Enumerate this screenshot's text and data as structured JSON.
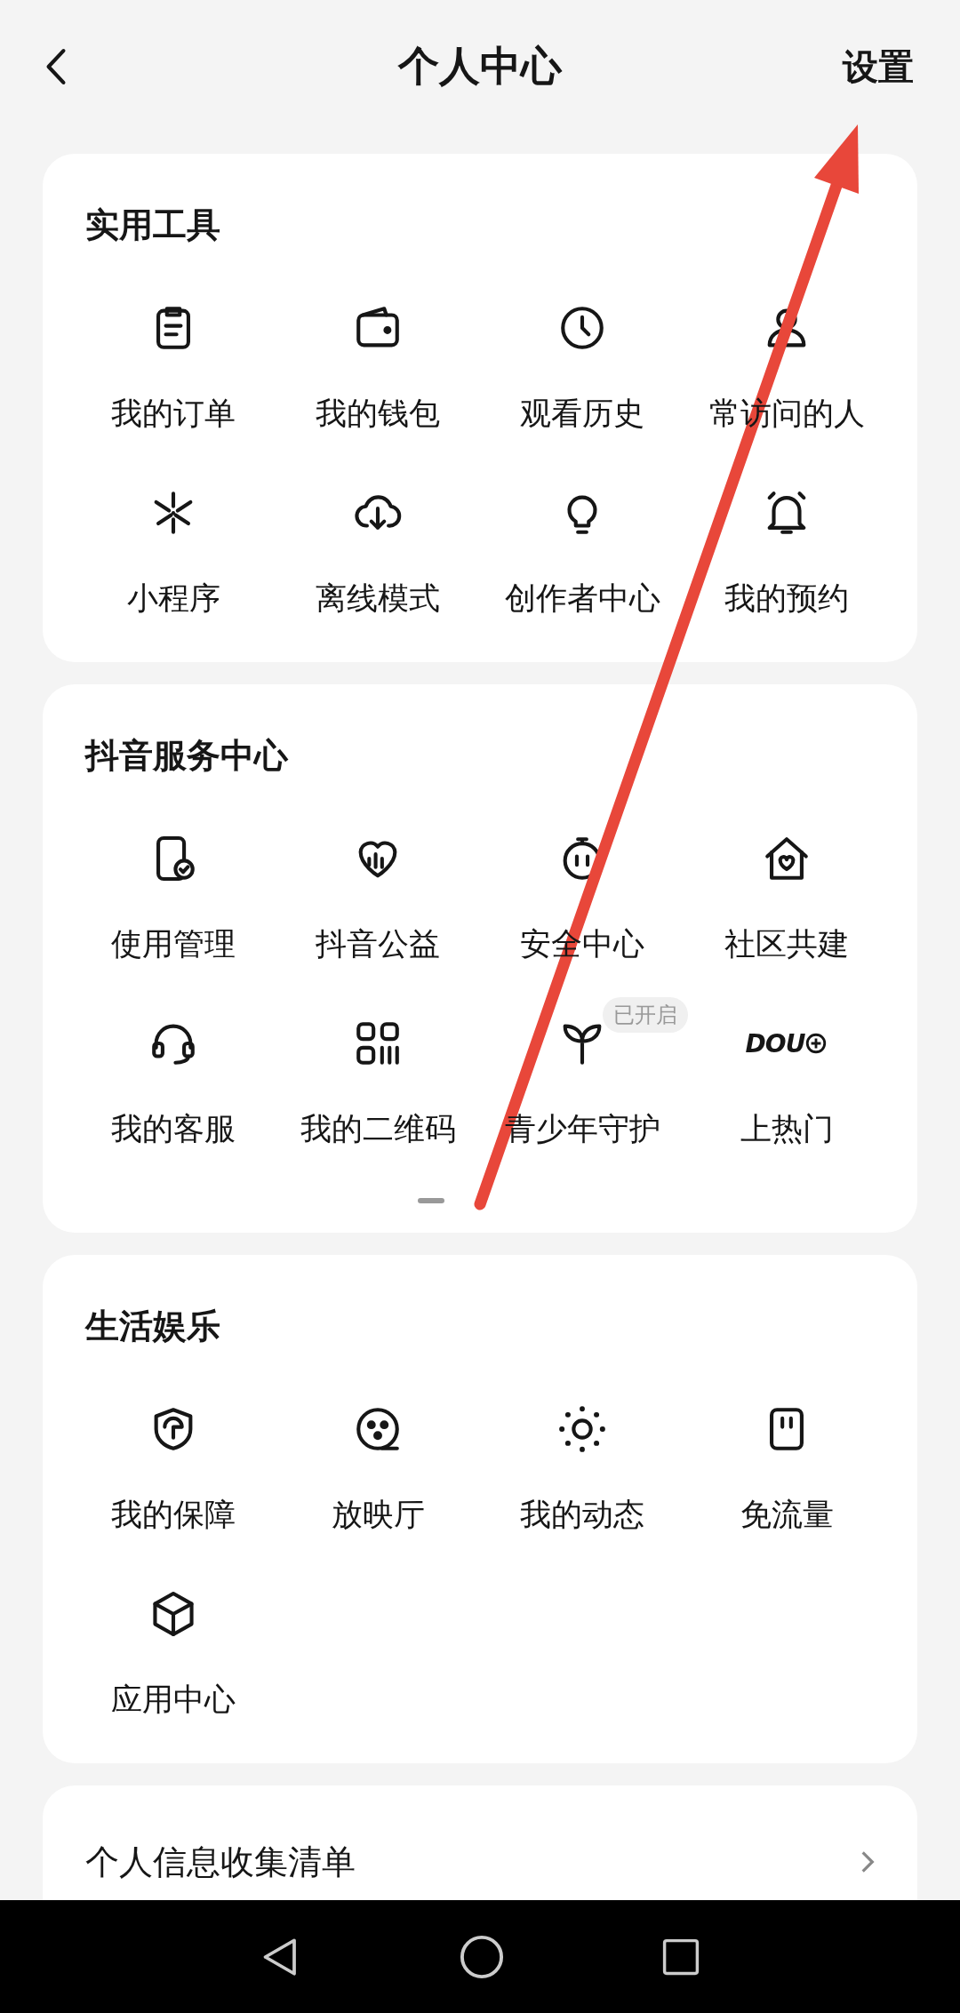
{
  "header": {
    "title": "个人中心",
    "action": "设置"
  },
  "sections": [
    {
      "title": "实用工具",
      "items": [
        {
          "label": "我的订单"
        },
        {
          "label": "我的钱包"
        },
        {
          "label": "观看历史"
        },
        {
          "label": "常访问的人"
        },
        {
          "label": "小程序"
        },
        {
          "label": "离线模式"
        },
        {
          "label": "创作者中心"
        },
        {
          "label": "我的预约"
        }
      ]
    },
    {
      "title": "抖音服务中心",
      "pager": true,
      "items": [
        {
          "label": "使用管理"
        },
        {
          "label": "抖音公益"
        },
        {
          "label": "安全中心"
        },
        {
          "label": "社区共建"
        },
        {
          "label": "我的客服"
        },
        {
          "label": "我的二维码"
        },
        {
          "label": "青少年守护",
          "badge": "已开启"
        },
        {
          "label": "上热门",
          "logo_text": "DOU"
        }
      ]
    },
    {
      "title": "生活娱乐",
      "items": [
        {
          "label": "我的保障"
        },
        {
          "label": "放映厅"
        },
        {
          "label": "我的动态"
        },
        {
          "label": "免流量"
        },
        {
          "label": "应用中心"
        }
      ]
    }
  ],
  "footer_card": {
    "label": "个人信息收集清单"
  },
  "annotation": {
    "kind": "arrow"
  }
}
